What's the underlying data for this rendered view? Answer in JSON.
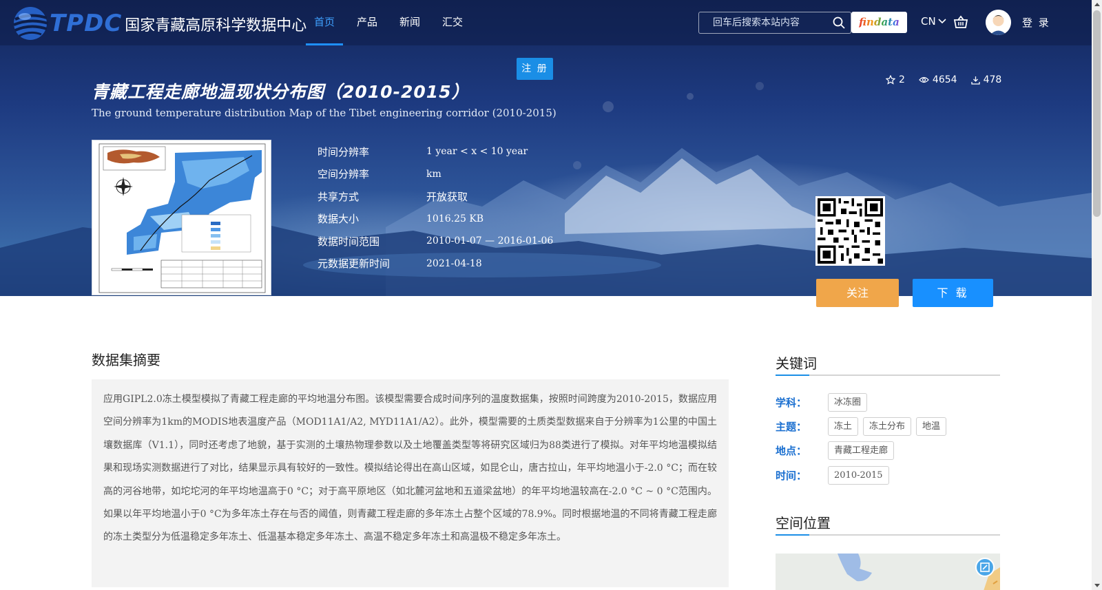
{
  "header": {
    "logo_abbr": "TPDC",
    "logo_name": "国家青藏高原科学数据中心",
    "nav": [
      {
        "label": "首页",
        "active": true
      },
      {
        "label": "产品",
        "active": false
      },
      {
        "label": "新闻",
        "active": false
      },
      {
        "label": "汇交",
        "active": false
      }
    ],
    "search_placeholder": "回车后搜索本站内容",
    "findata_label": "findata",
    "lang_label": "CN",
    "login_label": "登 录"
  },
  "register_label": "注 册",
  "dataset": {
    "title_cn": "青藏工程走廊地温现状分布图（2010-2015）",
    "title_en": "The ground temperature distribution Map of the Tibet engineering corridor (2010-2015)",
    "stats": {
      "stars": "2",
      "views": "4654",
      "downloads": "478"
    },
    "meta": [
      {
        "label": "时间分辨率",
        "value": "1 year < x < 10 year"
      },
      {
        "label": "空间分辨率",
        "value": "km"
      },
      {
        "label": "共享方式",
        "value": "开放获取"
      },
      {
        "label": "数据大小",
        "value": "1016.25 KB"
      },
      {
        "label": "数据时间范围",
        "value": "2010-01-07 — 2016-01-06"
      },
      {
        "label": "元数据更新时间",
        "value": "2021-04-18"
      }
    ],
    "follow_label": "关注",
    "download_label": "下 载"
  },
  "abstract": {
    "title": "数据集摘要",
    "text": "应用GIPL2.0冻土模型模拟了青藏工程走廊的平均地温分布图。该模型需要合成时间序列的温度数据集，按照时间跨度为2010-2015，数据应用空间分辨率为1km的MODIS地表温度产品（MOD11A1/A2, MYD11A1/A2）。此外，模型需要的土质类型数据来自于分辨率为1公里的中国土壤数据库（V1.1），同时还考虑了地貌，基于实测的土壤热物理参数以及土地覆盖类型等将研究区域归为88类进行了模拟。对年平均地温模拟结果和现场实测数据进行了对比，结果显示具有较好的一致性。模拟结论得出在高山区域，如昆仑山，唐古拉山，年平均地温小于-2.0 °C；而在较高的河谷地带，如坨坨河的年平均地温高于0 °C；对于高平原地区（如北麓河盆地和五道梁盆地）的年平均地温较高在-2.0 °C ~ 0 °C范围内。如果以年平均地温小于0 °C为多年冻土存在与否的阈值，则青藏工程走廊的多年冻土占整个区域的78.9%。同时根据地温的不同将青藏工程走廊的冻土类型分为低温稳定多年冻土、低温基本稳定多年冻土、高温不稳定多年冻土和高温极不稳定多年冻土。"
  },
  "keywords": {
    "title": "关键词",
    "rows": [
      {
        "label": "学科：",
        "tags": [
          "冰冻圈"
        ]
      },
      {
        "label": "主题：",
        "tags": [
          "冻土",
          "冻土分布",
          "地温"
        ]
      },
      {
        "label": "地点：",
        "tags": [
          "青藏工程走廊"
        ]
      },
      {
        "label": "时间：",
        "tags": [
          "2010-2015"
        ]
      }
    ]
  },
  "location": {
    "title": "空间位置"
  },
  "colors": {
    "accent": "#1890ff",
    "follow": "#f0a64a",
    "keyword_label": "#1a6fd0"
  }
}
